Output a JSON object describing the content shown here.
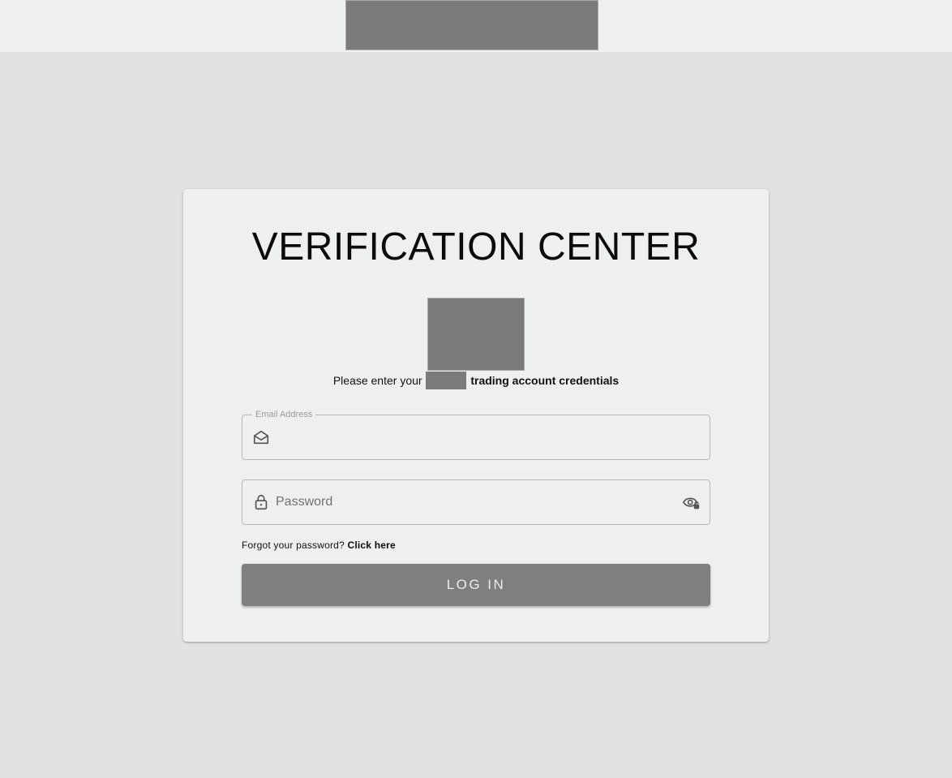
{
  "header": {
    "logo": "redacted-logo"
  },
  "login_card": {
    "title": "VERIFICATION CENTER",
    "brand_image": "redacted-brand-image",
    "subtitle": {
      "before": "Please enter your",
      "redacted_word": "",
      "after": "trading account credentials"
    },
    "email": {
      "label": "Email Address",
      "value": "",
      "placeholder": "",
      "icon": "envelope-open-icon"
    },
    "password": {
      "label": "",
      "value": "",
      "placeholder": "Password",
      "icon": "lock-icon",
      "toggle_icon": "eye-lock-icon"
    },
    "forgot": {
      "text": "Forgot your password?",
      "link": "Click here"
    },
    "login_button": "LOG IN"
  },
  "colors": {
    "page_background": "#e2e2e2",
    "card_background": "#eef0ef",
    "button_background": "#7f7f7f",
    "redaction": "#7b7b7b"
  }
}
